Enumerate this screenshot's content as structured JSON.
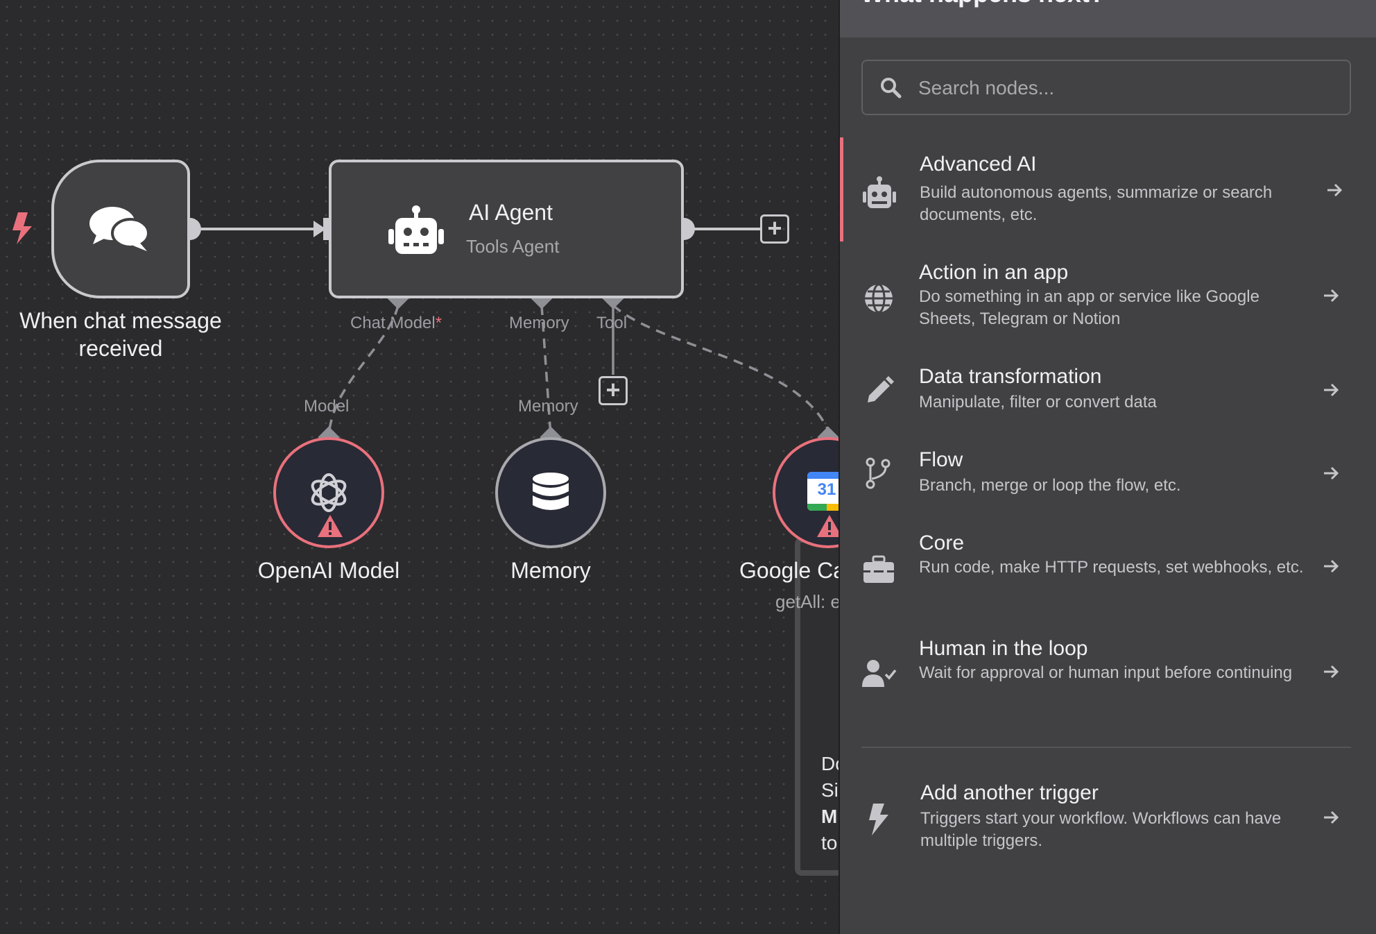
{
  "canvas": {
    "trigger": {
      "label": "When chat message received"
    },
    "agent": {
      "title": "AI Agent",
      "subtitle": "Tools Agent"
    },
    "ports": {
      "chat_model": "Chat Model",
      "chat_model_required": "*",
      "memory": "Memory",
      "tool": "Tool"
    },
    "sub_nodes": [
      {
        "port_label": "Model",
        "label": "OpenAI Model",
        "status": "warning"
      },
      {
        "port_label": "Memory",
        "label": "Memory",
        "status": "ok"
      },
      {
        "label": "Google Ca",
        "sublabel": "getAll: e",
        "status": "warning",
        "badge": "31"
      }
    ],
    "sticky_note_lines": [
      "Do",
      "Sir",
      "M",
      "to"
    ]
  },
  "panel": {
    "title": "What happens next?",
    "search_placeholder": "Search nodes...",
    "categories": [
      {
        "title": "Advanced AI",
        "description": "Build autonomous agents, summarize or search documents, etc.",
        "icon": "robot-icon"
      },
      {
        "title": "Action in an app",
        "description": "Do something in an app or service like Google Sheets, Telegram or Notion",
        "icon": "globe-icon"
      },
      {
        "title": "Data transformation",
        "description": "Manipulate, filter or convert data",
        "icon": "pencil-icon"
      },
      {
        "title": "Flow",
        "description": "Branch, merge or loop the flow, etc.",
        "icon": "branch-icon"
      },
      {
        "title": "Core",
        "description": "Run code, make HTTP requests, set webhooks, etc.",
        "icon": "toolbox-icon"
      },
      {
        "title": "Human in the loop",
        "description": "Wait for approval or human input before continuing",
        "icon": "user-check-icon"
      }
    ],
    "trigger_item": {
      "title": "Add another trigger",
      "description": "Triggers start your workflow. Workflows can have multiple triggers.",
      "icon": "bolt-icon"
    }
  },
  "colors": {
    "accent": "#e9717d",
    "canvas_bg": "#2b2b2d",
    "panel_bg": "#414144",
    "node_border": "#c9c9ce"
  }
}
